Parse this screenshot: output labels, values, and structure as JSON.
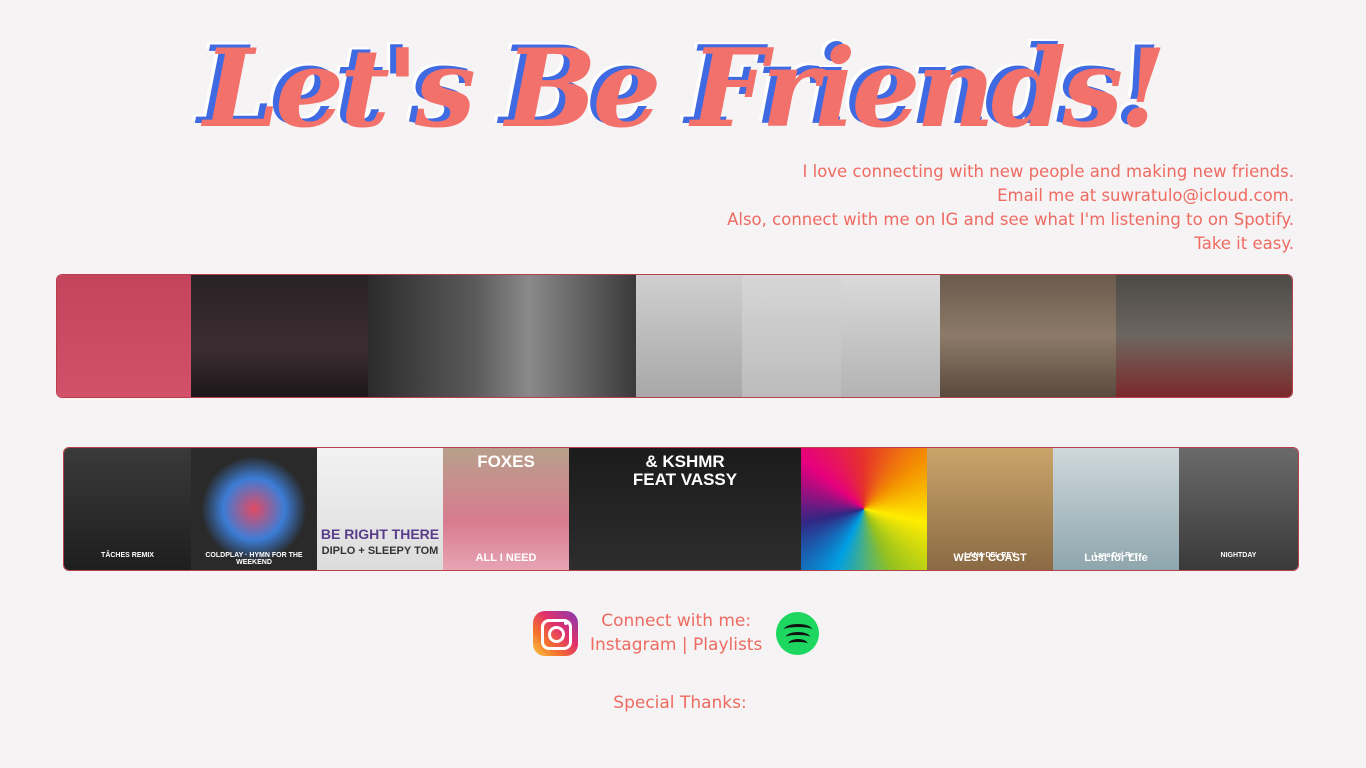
{
  "page": {
    "title": "Let's Be Friends!",
    "intro_lines": [
      "I love connecting with new people and making new friends.",
      "Email me at suwratulo@icloud.com.",
      "Also, connect with me on IG and see what I'm listening to on Spotify.",
      "Take it easy."
    ]
  },
  "photos": [
    {
      "name": "photo-man-in-blue-suit",
      "bg": "linear-gradient(180deg,#c4445c 0%,#d2516a 100%)"
    },
    {
      "name": "photo-group-at-theater",
      "bg": "linear-gradient(180deg,#2a2226 0%,#3b2d32 60%,#1d1719 100%)"
    },
    {
      "name": "photo-couple-bw",
      "bg": "linear-gradient(90deg,#2b2b2b 0%,#5a5a5a 40%,#8a8a8a 60%,#3a3a3a 100%)"
    },
    {
      "name": "photo-sketch-portraits",
      "bg": "linear-gradient(180deg,#cfcfcf 0%,#a8a8a8 100%)"
    },
    {
      "name": "photo-sketch-woman",
      "bg": "linear-gradient(180deg,#d6d6d6 0%,#bcbcbc 100%)"
    },
    {
      "name": "photo-sketch-superman",
      "bg": "linear-gradient(180deg,#dadada 0%,#b3b3b3 100%)"
    },
    {
      "name": "photo-two-women-couch",
      "bg": "linear-gradient(180deg,#6b5b4d 0%,#8d7a68 50%,#5a4a3e 100%)"
    },
    {
      "name": "photo-group-red-chairs",
      "bg": "linear-gradient(180deg,#4c4a46 0%,#6d6660 50%,#7a2a2a 100%)"
    }
  ],
  "albums": [
    {
      "name": "album-zhu-taches-remix",
      "bg": "linear-gradient(180deg,#3a3a3a 0%,#1e1e1e 100%)",
      "caption": "TÂCHES REMIX"
    },
    {
      "name": "album-coldplay-hymn",
      "bg": "radial-gradient(circle,#e24a64 0%,#3c7dd6 35%,#2a2a2a 60%)",
      "caption": "COLDPLAY · HYMN FOR THE WEEKEND"
    },
    {
      "name": "album-be-right-there",
      "bg": "linear-gradient(180deg,#f2f2f2 0%,#dcdcdc 100%)",
      "caption": "BE RIGHT THERE",
      "sub": "DIPLO + SLEEPY TOM"
    },
    {
      "name": "album-foxes-all-i-need",
      "bg": "linear-gradient(180deg,#b7a08b 0%,#d87b8f 60%,#e7a4b3 100%)",
      "caption": "FOXES",
      "sub": "ALL I NEED"
    },
    {
      "name": "album-kshmr-secrets",
      "bg": "linear-gradient(180deg,#1b1b1b 0%,#2d2d2d 100%)",
      "caption": "& KSHMR",
      "sub": "FEAT VASSY"
    },
    {
      "name": "album-jamie-xx",
      "bg": "conic-gradient(#e6332a,#f39200,#ffed00,#95c11f,#009fe3,#312783,#e6007e,#e6332a)"
    },
    {
      "name": "album-lana-west-coast",
      "bg": "linear-gradient(180deg,#caa56a 0%,#8a6a44 100%)",
      "caption": "LANA DEL REY",
      "sub": "WEST COAST"
    },
    {
      "name": "album-lana-lust-for-life",
      "bg": "linear-gradient(180deg,#cfd8dc 0%,#8ea6ad 100%)",
      "caption": "Lana Del Rey",
      "sub": "Lust for Life"
    },
    {
      "name": "album-zhu-nightday",
      "bg": "linear-gradient(180deg,#6a6a6a 0%,#3a3a3a 100%)",
      "caption": "NIGHTDAY"
    }
  ],
  "connect": {
    "label": "Connect with me:",
    "instagram_link": "Instagram",
    "separator": "|",
    "playlists_link": "Playlists"
  },
  "footer": {
    "thanks": "Special Thanks:"
  },
  "colors": {
    "accent": "#ee6b62",
    "title_shadow": "#3f6ae2",
    "background": "#f6f3f4",
    "strip_border": "#b8404a",
    "spotify": "#1ed760"
  }
}
